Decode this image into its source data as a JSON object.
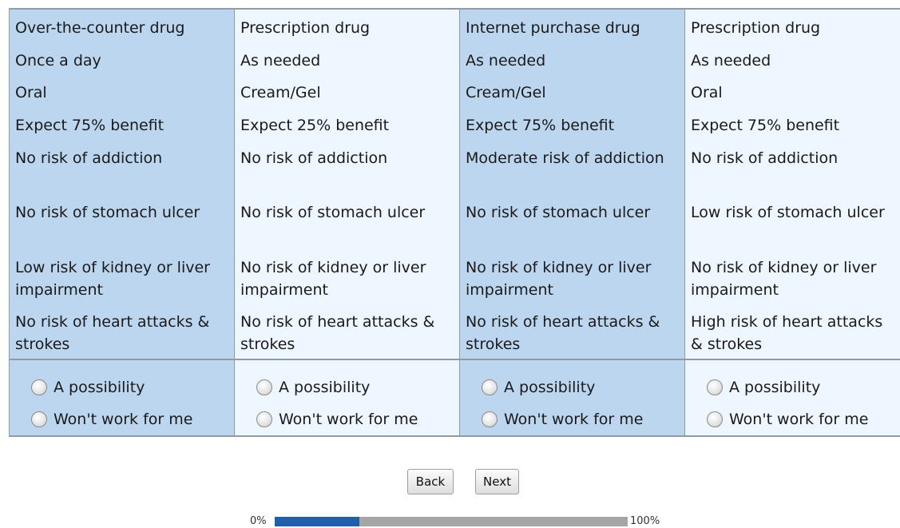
{
  "profiles": [
    {
      "shade": "shade",
      "attributes": [
        "Over-the-counter drug",
        "Once a day",
        "Oral",
        "Expect 75% benefit",
        "No risk of addiction",
        "No risk of stomach ulcer",
        "Low risk of kidney or liver impairment",
        "No risk of heart attacks & strokes"
      ]
    },
    {
      "shade": "light",
      "attributes": [
        "Prescription drug",
        "As needed",
        "Cream/Gel",
        "Expect 25% benefit",
        "No risk of addiction",
        "No risk of stomach ulcer",
        "No risk of kidney or liver impairment",
        "No risk of heart attacks & strokes"
      ]
    },
    {
      "shade": "shade",
      "attributes": [
        "Internet purchase drug",
        "As needed",
        "Cream/Gel",
        "Expect 75% benefit",
        "Moderate risk of addiction",
        "No risk of stomach ulcer",
        "No risk of kidney or liver impairment",
        "No risk of heart attacks & strokes"
      ]
    },
    {
      "shade": "light",
      "attributes": [
        "Prescription drug",
        "As needed",
        "Oral",
        "Expect 75% benefit",
        "No risk of addiction",
        "Low risk of stomach ulcer",
        "No risk of kidney or liver impairment",
        "High risk of heart attacks & strokes"
      ]
    }
  ],
  "choices": {
    "possibility_label": "A possibility",
    "wont_work_label": "Won't work for me"
  },
  "navigation": {
    "back_label": "Back",
    "next_label": "Next"
  },
  "progress": {
    "start_label": "0%",
    "end_label": "100%",
    "percent": 24
  },
  "colors": {
    "shaded_column": "#bcd6ef",
    "light_column": "#eef6ff",
    "progress_fill": "#1f5fad",
    "progress_track": "#a6a6a6"
  }
}
